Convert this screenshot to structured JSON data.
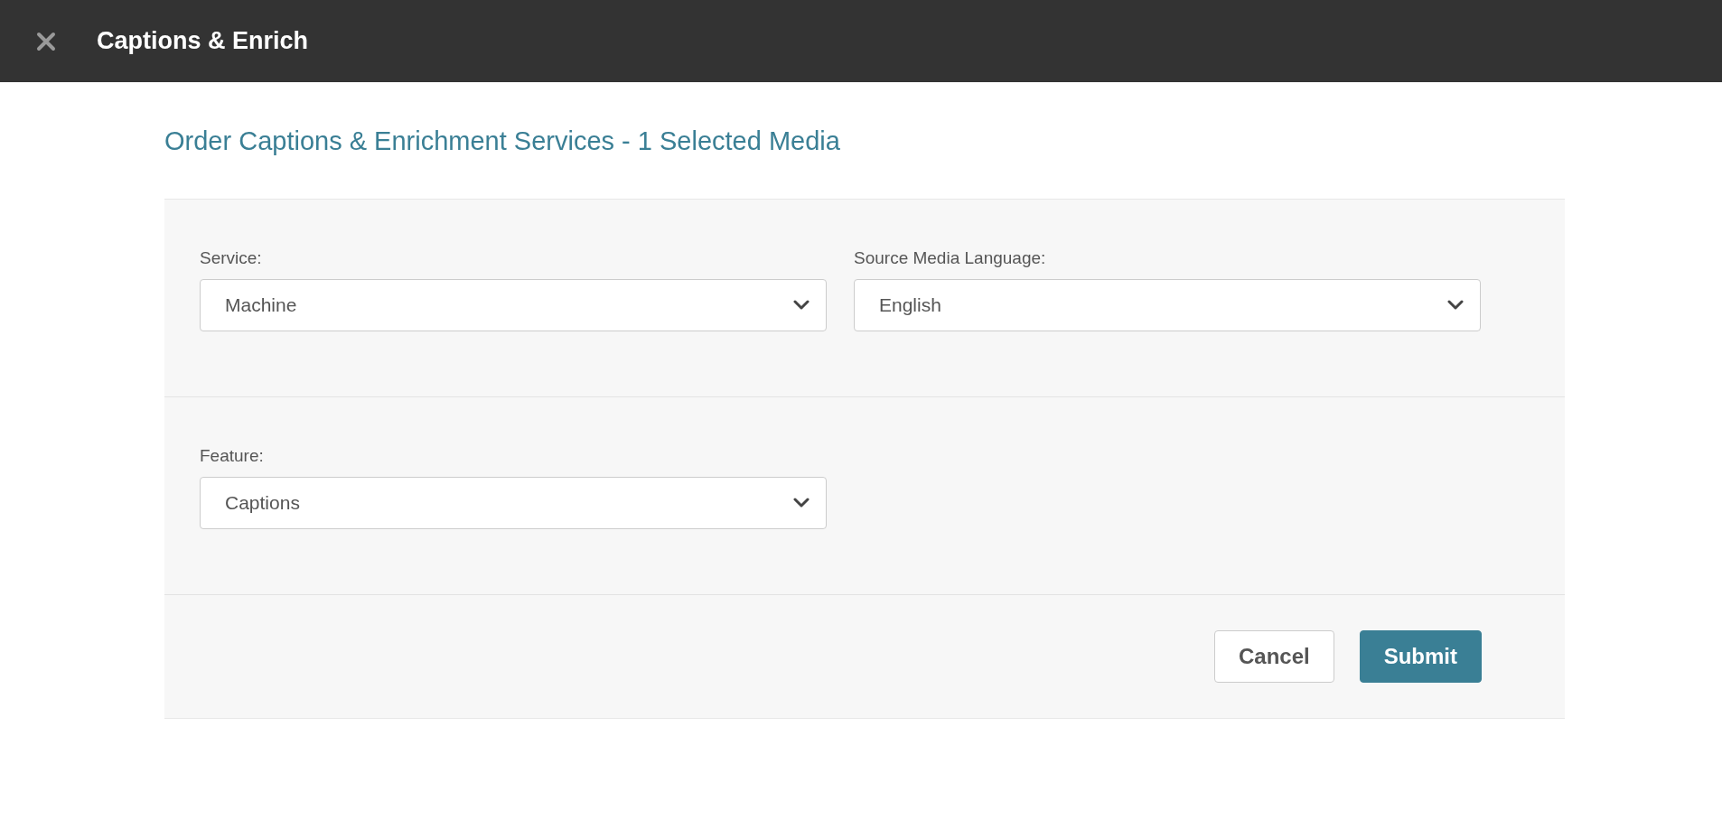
{
  "header": {
    "title": "Captions & Enrich"
  },
  "heading": "Order Captions & Enrichment Services - 1 Selected Media",
  "sections": [
    {
      "fields": [
        {
          "label": "Service:",
          "value": "Machine"
        },
        {
          "label": "Source Media Language:",
          "value": "English"
        }
      ]
    },
    {
      "fields": [
        {
          "label": "Feature:",
          "value": "Captions"
        }
      ]
    }
  ],
  "buttons": [
    {
      "label": "Cancel",
      "kind": "secondary"
    },
    {
      "label": "Submit",
      "kind": "primary"
    }
  ]
}
